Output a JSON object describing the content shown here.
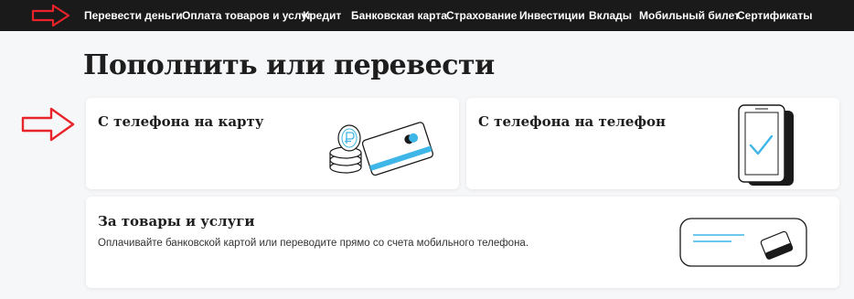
{
  "topnav": {
    "items": [
      {
        "label": "Перевести деньги"
      },
      {
        "label": "Оплата товаров и услуг"
      },
      {
        "label": "Кредит"
      },
      {
        "label": "Банковская карта"
      },
      {
        "label": "Страхование"
      },
      {
        "label": "Инвестиции"
      },
      {
        "label": "Вклады"
      },
      {
        "label": "Мобильный билет"
      },
      {
        "label": "Сертификаты"
      }
    ]
  },
  "page": {
    "title": "Пополнить или перевести"
  },
  "cards": [
    {
      "title": "С телефона на карту",
      "illustration": "coins-and-card-icon"
    },
    {
      "title": "С телефона на телефон",
      "illustration": "phone-checkmark-icon"
    },
    {
      "title": "За товары и услуги",
      "description": "Оплачивайте банковской картой или переводите прямо со счета мобильного телефона.",
      "illustration": "wallet-card-icon"
    }
  ],
  "colors": {
    "nav_background": "#1a1a1a",
    "accent": "#3fb6e8",
    "annotation_arrow": "#e8232a",
    "page_background": "#f6f7f8"
  }
}
